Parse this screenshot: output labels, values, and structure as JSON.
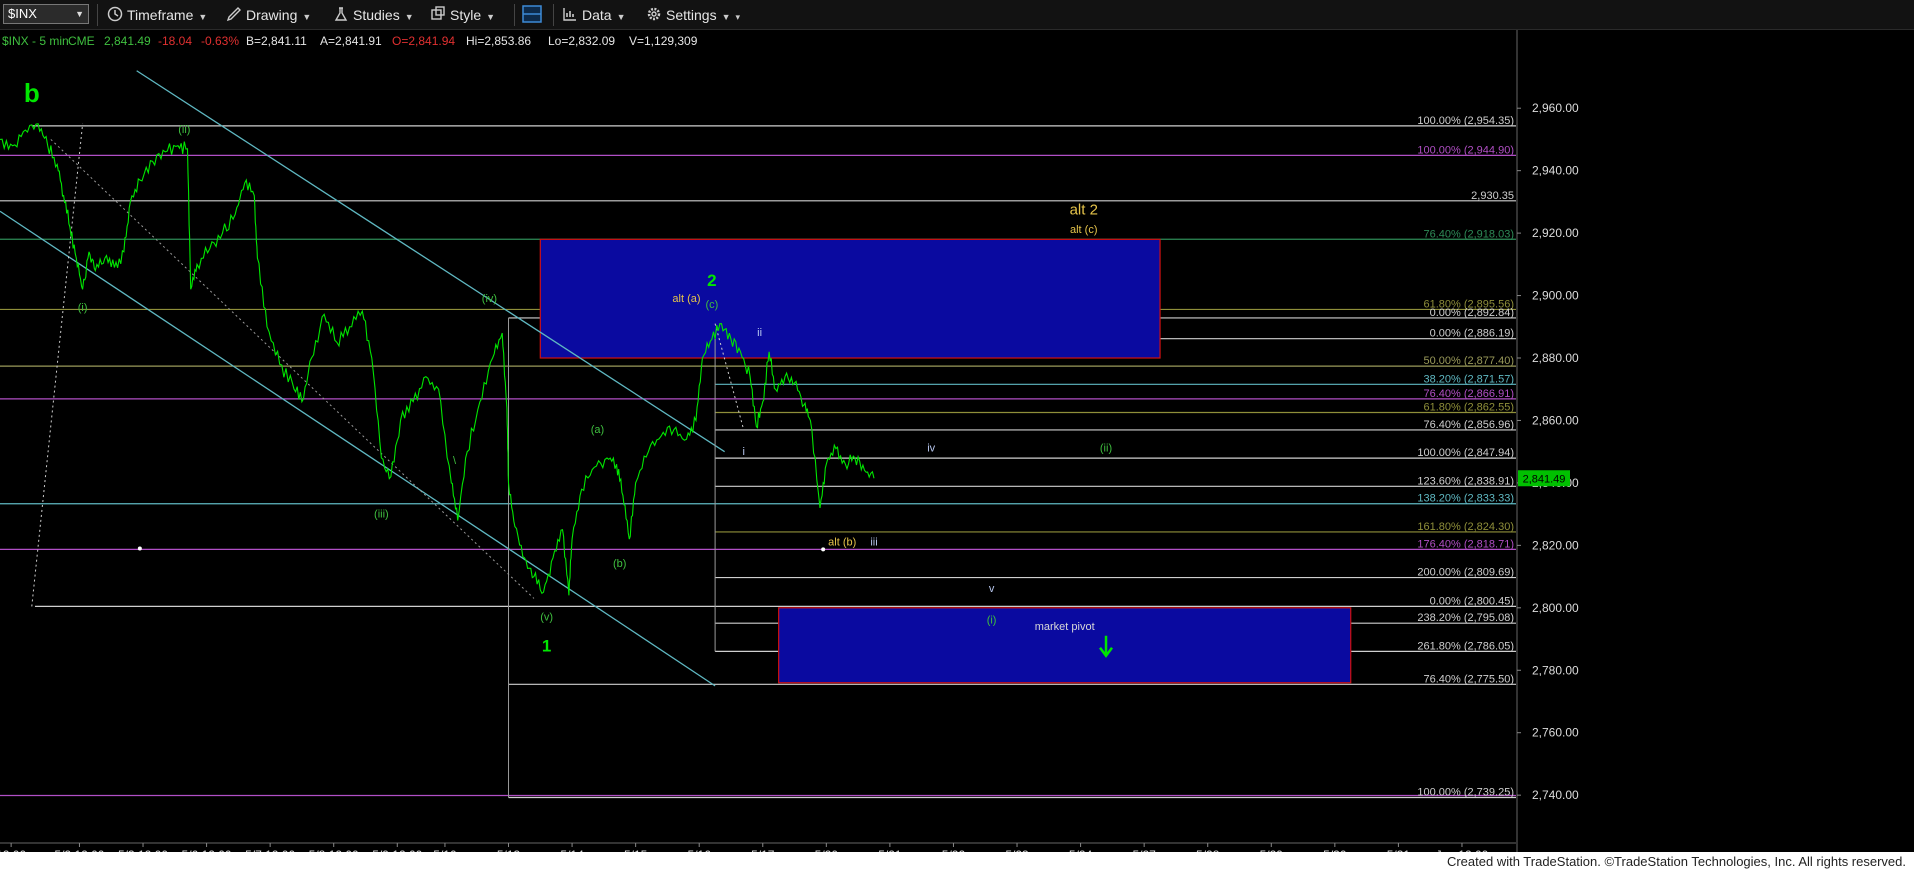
{
  "toolbar": {
    "symbol": "$INX",
    "items": [
      {
        "name": "timeframe-menu",
        "label": "Timeframe",
        "icon": "timeframe-icon"
      },
      {
        "name": "drawing-menu",
        "label": "Drawing",
        "icon": "drawing-icon"
      },
      {
        "name": "studies-menu",
        "label": "Studies",
        "icon": "studies-icon"
      },
      {
        "name": "style-menu",
        "label": "Style",
        "icon": "style-icon"
      },
      {
        "name": "data-menu",
        "label": "Data",
        "icon": "data-icon"
      },
      {
        "name": "settings-menu",
        "label": "Settings",
        "icon": "gear-icon"
      }
    ]
  },
  "quote": {
    "symbol_line": "$INX - 5 min",
    "exchange": "CME",
    "last": "2,841.49",
    "change": "-18.04",
    "change_pct": "-0.63%",
    "bid": "B=2,841.11",
    "ask": "A=2,841.91",
    "open": "O=2,841.94",
    "high": "Hi=2,853.86",
    "low": "Lo=2,832.09",
    "volume": "V=1,129,309"
  },
  "footer": {
    "text": "Created with TradeStation. ©TradeStation Technologies, Inc. All rights reserved."
  },
  "chart_data": {
    "type": "line",
    "title": "$INX - 5 min",
    "xlabel": "",
    "ylabel": "",
    "ylim": [
      2725,
      2978
    ],
    "xlim": [
      0,
      43
    ],
    "x_ticks": [
      {
        "x": 0.35,
        "label": "12:00"
      },
      {
        "x": 2.5,
        "label": "5/2 12:00"
      },
      {
        "x": 4.5,
        "label": "5/3 12:00"
      },
      {
        "x": 6.5,
        "label": "5/6 12:00"
      },
      {
        "x": 8.5,
        "label": "5/7 12:00"
      },
      {
        "x": 10.5,
        "label": "5/8 12:00"
      },
      {
        "x": 12.5,
        "label": "5/9 12:00"
      },
      {
        "x": 14.0,
        "label": "5/10"
      },
      {
        "x": 16.0,
        "label": "5/13"
      },
      {
        "x": 18.0,
        "label": "5/14"
      },
      {
        "x": 20.0,
        "label": "5/15"
      },
      {
        "x": 22.0,
        "label": "5/16"
      },
      {
        "x": 24.0,
        "label": "5/17"
      },
      {
        "x": 26.0,
        "label": "5/20"
      },
      {
        "x": 28.0,
        "label": "5/21"
      },
      {
        "x": 30.0,
        "label": "5/22"
      },
      {
        "x": 32.0,
        "label": "5/23"
      },
      {
        "x": 34.0,
        "label": "5/24"
      },
      {
        "x": 36.0,
        "label": "5/27"
      },
      {
        "x": 38.0,
        "label": "5/28"
      },
      {
        "x": 40.0,
        "label": "5/29"
      },
      {
        "x": 42.0,
        "label": "5/30"
      },
      {
        "x": 44.0,
        "label": "5/31"
      },
      {
        "x": 46.0,
        "label": "Jun 12:00"
      }
    ],
    "y_ticks": [
      "2,740.00",
      "2,760.00",
      "2,780.00",
      "2,800.00",
      "2,820.00",
      "2,840.00",
      "2,860.00",
      "2,880.00",
      "2,900.00",
      "2,920.00",
      "2,940.00",
      "2,960.00"
    ],
    "y_tick_values": [
      2740,
      2760,
      2780,
      2800,
      2820,
      2840,
      2860,
      2880,
      2900,
      2920,
      2940,
      2960
    ],
    "last_price": {
      "value": 2841.49,
      "label": "2,841.49"
    },
    "series": [
      {
        "color": "#00e600",
        "points": [
          [
            0.0,
            2950
          ],
          [
            0.4,
            2948
          ],
          [
            0.8,
            2953
          ],
          [
            1.2,
            2955
          ],
          [
            1.5,
            2948
          ],
          [
            1.8,
            2942
          ],
          [
            2.0,
            2932
          ],
          [
            2.2,
            2922
          ],
          [
            2.4,
            2912
          ],
          [
            2.6,
            2902
          ],
          [
            2.8,
            2914
          ],
          [
            3.0,
            2908
          ],
          [
            3.3,
            2912
          ],
          [
            3.6,
            2909
          ],
          [
            3.9,
            2914
          ],
          [
            4.1,
            2930
          ],
          [
            4.4,
            2937
          ],
          [
            4.8,
            2943
          ],
          [
            5.2,
            2946
          ],
          [
            5.6,
            2948
          ],
          [
            5.9,
            2947
          ],
          [
            6.0,
            2902
          ],
          [
            6.2,
            2910
          ],
          [
            6.6,
            2915
          ],
          [
            7.0,
            2920
          ],
          [
            7.4,
            2926
          ],
          [
            7.7,
            2936
          ],
          [
            8.0,
            2932
          ],
          [
            8.1,
            2912
          ],
          [
            8.4,
            2890
          ],
          [
            8.8,
            2878
          ],
          [
            9.2,
            2872
          ],
          [
            9.5,
            2866
          ],
          [
            9.8,
            2880
          ],
          [
            10.2,
            2894
          ],
          [
            10.6,
            2885
          ],
          [
            11.0,
            2890
          ],
          [
            11.4,
            2895
          ],
          [
            11.7,
            2880
          ],
          [
            12.0,
            2848
          ],
          [
            12.3,
            2842
          ],
          [
            12.6,
            2860
          ],
          [
            13.0,
            2866
          ],
          [
            13.4,
            2874
          ],
          [
            13.8,
            2870
          ],
          [
            14.2,
            2840
          ],
          [
            14.4,
            2828
          ],
          [
            14.7,
            2850
          ],
          [
            15.1,
            2866
          ],
          [
            15.5,
            2880
          ],
          [
            15.8,
            2888
          ],
          [
            15.95,
            2864
          ],
          [
            16.0,
            2840
          ],
          [
            16.2,
            2826
          ],
          [
            16.5,
            2816
          ],
          [
            16.8,
            2810
          ],
          [
            17.1,
            2805
          ],
          [
            17.4,
            2816
          ],
          [
            17.7,
            2825
          ],
          [
            17.9,
            2804
          ],
          [
            18.0,
            2822
          ],
          [
            18.3,
            2838
          ],
          [
            18.7,
            2845
          ],
          [
            19.1,
            2848
          ],
          [
            19.4,
            2846
          ],
          [
            19.6,
            2836
          ],
          [
            19.8,
            2822
          ],
          [
            20.0,
            2840
          ],
          [
            20.4,
            2850
          ],
          [
            20.8,
            2855
          ],
          [
            21.2,
            2857
          ],
          [
            21.6,
            2854
          ],
          [
            21.9,
            2860
          ],
          [
            22.1,
            2880
          ],
          [
            22.4,
            2886
          ],
          [
            22.7,
            2891
          ],
          [
            23.0,
            2886
          ],
          [
            23.3,
            2882
          ],
          [
            23.6,
            2874
          ],
          [
            23.8,
            2858
          ],
          [
            24.0,
            2866
          ],
          [
            24.2,
            2882
          ],
          [
            24.4,
            2870
          ],
          [
            24.7,
            2874
          ],
          [
            25.0,
            2872
          ],
          [
            25.3,
            2865
          ],
          [
            25.5,
            2860
          ],
          [
            25.8,
            2832
          ],
          [
            26.0,
            2846
          ],
          [
            26.3,
            2851
          ],
          [
            26.6,
            2846
          ],
          [
            26.9,
            2848
          ],
          [
            27.2,
            2844
          ],
          [
            27.5,
            2841.49
          ]
        ]
      }
    ],
    "levels": [
      {
        "value": 2954.35,
        "label": "100.00% (2,954.35)",
        "color": "#cfcfcf",
        "x1": 1.0
      },
      {
        "value": 2944.9,
        "label": "100.00% (2,944.90)",
        "color": "#b14fc5",
        "x1": 0.0
      },
      {
        "value": 2930.35,
        "label": "2,930.35",
        "color": "#cfcfcf",
        "x1": 0.0
      },
      {
        "value": 2918.03,
        "label": "76.40% (2,918.03)",
        "color": "#2e8b57",
        "x1": 0.0
      },
      {
        "value": 2895.56,
        "label": "61.80% (2,895.56)",
        "color": "#8f8f3a",
        "x1": 0.0
      },
      {
        "value": 2892.84,
        "label": "0.00% (2,892.84)",
        "color": "#cfcfcf",
        "x1": 16.0
      },
      {
        "value": 2886.19,
        "label": "0.00% (2,886.19)",
        "color": "#cfcfcf",
        "x1": 22.5
      },
      {
        "value": 2877.4,
        "label": "50.00% (2,877.40)",
        "color": "#9a9a5a",
        "x1": 0.0
      },
      {
        "value": 2871.57,
        "label": "38.20% (2,871.57)",
        "color": "#5fb8c2",
        "x1": 22.5
      },
      {
        "value": 2866.91,
        "label": "76.40% (2,866.91)",
        "color": "#b14fc5",
        "x1": 0.0
      },
      {
        "value": 2862.55,
        "label": "61.80% (2,862.55)",
        "color": "#8f8f3a",
        "x1": 22.5
      },
      {
        "value": 2856.96,
        "label": "76.40% (2,856.96)",
        "color": "#cfcfcf",
        "x1": 22.5
      },
      {
        "value": 2847.94,
        "label": "100.00% (2,847.94)",
        "color": "#cfcfcf",
        "x1": 22.5
      },
      {
        "value": 2838.91,
        "label": "123.60% (2,838.91)",
        "color": "#cfcfcf",
        "x1": 22.5
      },
      {
        "value": 2833.33,
        "label": "138.20% (2,833.33)",
        "color": "#5fb8c2",
        "x1": 0.0
      },
      {
        "value": 2824.3,
        "label": "161.80% (2,824.30)",
        "color": "#8f8f3a",
        "x1": 22.5
      },
      {
        "value": 2818.71,
        "label": "176.40% (2,818.71)",
        "color": "#b14fc5",
        "x1": 0.0
      },
      {
        "value": 2809.69,
        "label": "200.00% (2,809.69)",
        "color": "#cfcfcf",
        "x1": 22.5
      },
      {
        "value": 2800.45,
        "label": "0.00% (2,800.45)",
        "color": "#cfcfcf",
        "x1": 1.1
      },
      {
        "value": 2795.08,
        "label": "238.20% (2,795.08)",
        "color": "#cfcfcf",
        "x1": 22.5
      },
      {
        "value": 2786.05,
        "label": "261.80% (2,786.05)",
        "color": "#cfcfcf",
        "x1": 22.5
      },
      {
        "value": 2775.5,
        "label": "76.40% (2,775.50)",
        "color": "#cfcfcf",
        "x1": 16.0
      },
      {
        "value": 2739.25,
        "label": "100.00% (2,739.25)",
        "color": "#cfcfcf",
        "x1": 16.0
      },
      {
        "value": 2739.9,
        "label": "",
        "color": "#b14fc5",
        "x1": 0.0
      }
    ],
    "zones": [
      {
        "x1": 17.0,
        "x2": 36.5,
        "y1": 2880,
        "y2": 2918,
        "color": "#0a0aa0",
        "border": "#d01010",
        "label": ""
      },
      {
        "x1": 24.5,
        "x2": 42.5,
        "y1": 2776,
        "y2": 2800,
        "color": "#0a0aa0",
        "border": "#d01010",
        "label": "market pivot"
      }
    ],
    "channel_lines": [
      {
        "from": [
          4.3,
          2972
        ],
        "to": [
          22.8,
          2850
        ],
        "color": "#5fb8c2"
      },
      {
        "from": [
          0.0,
          2927
        ],
        "to": [
          22.5,
          2775
        ],
        "color": "#5fb8c2"
      }
    ],
    "wave_labels": [
      {
        "x": 1.0,
        "y": 2962,
        "text": "b",
        "color": "#00e600",
        "size": 26,
        "weight": "bold"
      },
      {
        "x": 2.6,
        "y": 2895,
        "text": "(i)",
        "color": "#3fbf3f",
        "size": 11
      },
      {
        "x": 5.8,
        "y": 2952,
        "text": "(ii)",
        "color": "#3fbf3f",
        "size": 11
      },
      {
        "x": 12.0,
        "y": 2829,
        "text": "(iii)",
        "color": "#3fbf3f",
        "size": 11
      },
      {
        "x": 14.3,
        "y": 2846,
        "text": "\\",
        "color": "#3fbf3f",
        "size": 11
      },
      {
        "x": 15.4,
        "y": 2898,
        "text": "(iv)",
        "color": "#3fbf3f",
        "size": 11
      },
      {
        "x": 17.2,
        "y": 2796,
        "text": "(v)",
        "color": "#3fbf3f",
        "size": 11
      },
      {
        "x": 17.2,
        "y": 2786,
        "text": "1",
        "color": "#00e600",
        "size": 17,
        "weight": "bold"
      },
      {
        "x": 18.8,
        "y": 2856,
        "text": "(a)",
        "color": "#3fbf3f",
        "size": 11
      },
      {
        "x": 19.5,
        "y": 2813,
        "text": "(b)",
        "color": "#3fbf3f",
        "size": 11
      },
      {
        "x": 21.6,
        "y": 2898,
        "text": "alt (a)",
        "color": "#e5c34a",
        "size": 11
      },
      {
        "x": 22.4,
        "y": 2903,
        "text": "2",
        "color": "#00e600",
        "size": 17,
        "weight": "bold"
      },
      {
        "x": 22.4,
        "y": 2896,
        "text": "(c)",
        "color": "#3fbf3f",
        "size": 11
      },
      {
        "x": 23.9,
        "y": 2887,
        "text": "ii",
        "color": "#b8c8f0",
        "size": 11
      },
      {
        "x": 23.4,
        "y": 2849,
        "text": "i",
        "color": "#b8c8f0",
        "size": 11
      },
      {
        "x": 26.5,
        "y": 2820,
        "text": "alt (b)",
        "color": "#e5c34a",
        "size": 11
      },
      {
        "x": 27.5,
        "y": 2820,
        "text": "iii",
        "color": "#b8c8f0",
        "size": 11
      },
      {
        "x": 29.3,
        "y": 2850,
        "text": "iv",
        "color": "#b8c8f0",
        "size": 11
      },
      {
        "x": 31.2,
        "y": 2805,
        "text": "v",
        "color": "#b8c8f0",
        "size": 11
      },
      {
        "x": 31.2,
        "y": 2795,
        "text": "(i)",
        "color": "#3fbf3f",
        "size": 11
      },
      {
        "x": 34.8,
        "y": 2850,
        "text": "(ii)",
        "color": "#3fbf3f",
        "size": 11
      },
      {
        "x": 34.1,
        "y": 2926,
        "text": "alt 2",
        "color": "#e5c34a",
        "size": 15
      },
      {
        "x": 34.1,
        "y": 2920,
        "text": "alt (c)",
        "color": "#e5c34a",
        "size": 11
      }
    ]
  }
}
